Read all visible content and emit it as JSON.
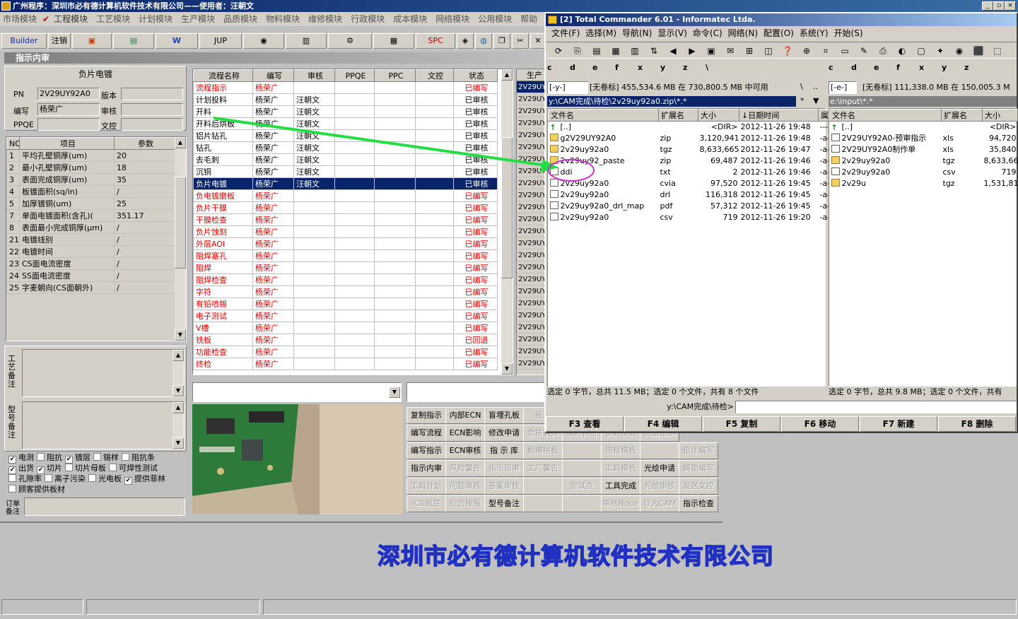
{
  "app": {
    "title": "广州程序：深圳市必有德计算机软件技术有限公司——使用者：汪朝文",
    "menus": [
      "市场模块",
      "工程模块",
      "工艺模块",
      "计划模块",
      "生产模块",
      "品质模块",
      "物料模块",
      "维修模块",
      "行政模块",
      "成本模块",
      "网络模块",
      "公用模块",
      "帮助"
    ],
    "toolbar": {
      "builder": "Builder",
      "logout": "注销",
      "jup": "JUP",
      "spc": "SPC"
    },
    "section_title": "指示内审"
  },
  "left": {
    "heading": "负片电镀",
    "pn_label": "PN",
    "pn_value": "2V29UY92A0",
    "version_label": "版本",
    "version_value": "",
    "author_label": "编写",
    "author_value": "杨荣广",
    "review_label": "审核",
    "review_value": "",
    "ppqe_label": "PPQE",
    "ppqe_value": "",
    "doc_label": "文控",
    "doc_value": "",
    "param_headers": [
      "NO",
      "项目",
      "参数"
    ],
    "params": [
      {
        "no": "1",
        "item": "平均孔壁铜厚(um)",
        "val": "20"
      },
      {
        "no": "2",
        "item": "最小孔壁铜厚(um)",
        "val": "18"
      },
      {
        "no": "3",
        "item": "表面完成铜厚(um)",
        "val": "35"
      },
      {
        "no": "4",
        "item": "板镀面积(sq/in)",
        "val": "/"
      },
      {
        "no": "5",
        "item": "加厚镀铜(um)",
        "val": "25"
      },
      {
        "no": "7",
        "item": "单面电镀面积(含孔)(",
        "val": "351.17"
      },
      {
        "no": "8",
        "item": "表面最小完成铜厚(μm)",
        "val": "/"
      },
      {
        "no": "21",
        "item": "电镀线别",
        "val": "/"
      },
      {
        "no": "22",
        "item": "电镀时间",
        "val": "/"
      },
      {
        "no": "23",
        "item": "CS面电流密度",
        "val": "/"
      },
      {
        "no": "24",
        "item": "SS面电流密度",
        "val": "/"
      },
      {
        "no": "25",
        "item": "字麦朝向(CS面朝外)",
        "val": "/"
      }
    ],
    "process_note_label": "工艺备注",
    "model_note_label": "型号备注",
    "order_note_label": "订单备注",
    "checkboxes": [
      [
        {
          "label": "电测",
          "checked": true
        },
        {
          "label": "阻抗",
          "checked": false
        },
        {
          "label": "镀层",
          "checked": true
        },
        {
          "label": "锡样",
          "checked": false
        },
        {
          "label": "阻抗条",
          "checked": false
        }
      ],
      [
        {
          "label": "出货",
          "checked": true
        },
        {
          "label": "切片",
          "checked": true
        },
        {
          "label": "切片母板",
          "checked": false
        },
        {
          "label": "可焊性测试",
          "checked": false
        }
      ],
      [
        {
          "label": "孔隙率",
          "checked": false
        },
        {
          "label": "离子污染",
          "checked": false
        },
        {
          "label": "光电板",
          "checked": false
        },
        {
          "label": "提供菲林",
          "checked": true
        }
      ],
      [
        {
          "label": "顾客提供板材",
          "checked": false
        }
      ]
    ]
  },
  "flow": {
    "headers": [
      "流程名称",
      "编写",
      "审核",
      "PPQE",
      "PPC",
      "文控",
      "状态"
    ],
    "rows": [
      {
        "name": "流程指示",
        "author": "杨荣广",
        "review": "",
        "status": "已编写",
        "red": true
      },
      {
        "name": "计划投料",
        "author": "杨荣广",
        "review": "汪朝文",
        "status": "已审核",
        "red": false
      },
      {
        "name": "开料",
        "author": "杨荣广",
        "review": "汪朝文",
        "status": "已审核",
        "red": false
      },
      {
        "name": "开料后烘板",
        "author": "杨荣广",
        "review": "汪朝文",
        "status": "已审核",
        "red": false
      },
      {
        "name": "铝片钻孔",
        "author": "杨荣广",
        "review": "汪朝文",
        "status": "已审核",
        "red": false
      },
      {
        "name": "钻孔",
        "author": "杨荣广",
        "review": "汪朝文",
        "status": "已审核",
        "red": false
      },
      {
        "name": "去毛刺",
        "author": "杨荣广",
        "review": "汪朝文",
        "status": "已审核",
        "red": false
      },
      {
        "name": "沉铜",
        "author": "杨荣广",
        "review": "汪朝文",
        "status": "已审核",
        "red": false
      },
      {
        "name": "负片电镀",
        "author": "杨荣广",
        "review": "汪朝文",
        "status": "已审核",
        "red": false,
        "selected": true
      },
      {
        "name": "负电镀磨板",
        "author": "杨荣广",
        "review": "",
        "status": "已编写",
        "red": true
      },
      {
        "name": "负片干膜",
        "author": "杨荣广",
        "review": "",
        "status": "已编写",
        "red": true
      },
      {
        "name": "干膜检查",
        "author": "杨荣广",
        "review": "",
        "status": "已编写",
        "red": true
      },
      {
        "name": "负片蚀刻",
        "author": "杨荣广",
        "review": "",
        "status": "已编写",
        "red": true
      },
      {
        "name": "外层AOI",
        "author": "杨荣广",
        "review": "",
        "status": "已编写",
        "red": true
      },
      {
        "name": "阻焊塞孔",
        "author": "杨荣广",
        "review": "",
        "status": "已编写",
        "red": true
      },
      {
        "name": "阻焊",
        "author": "杨荣广",
        "review": "",
        "status": "已编写",
        "red": true
      },
      {
        "name": "阻焊检查",
        "author": "杨荣广",
        "review": "",
        "status": "已编写",
        "red": true
      },
      {
        "name": "字符",
        "author": "杨荣广",
        "review": "",
        "status": "已编写",
        "red": true
      },
      {
        "name": "有铅喷锡",
        "author": "杨荣广",
        "review": "",
        "status": "已编写",
        "red": true
      },
      {
        "name": "电子测试",
        "author": "杨荣广",
        "review": "",
        "status": "已编写",
        "red": true
      },
      {
        "name": "V槽",
        "author": "杨荣广",
        "review": "",
        "status": "已编写",
        "red": true
      },
      {
        "name": "铣板",
        "author": "杨荣广",
        "review": "",
        "status": "已回退",
        "red": true
      },
      {
        "name": "功能检查",
        "author": "杨荣广",
        "review": "",
        "status": "已编写",
        "red": true
      },
      {
        "name": "终检",
        "author": "杨荣广",
        "review": "",
        "status": "已编写",
        "red": true
      }
    ],
    "side_header": "生产",
    "side_values": [
      "2V29UY",
      "2V29UY",
      "2V29UY",
      "2V29UY",
      "2V29UY",
      "2V29UY",
      "2V29UY",
      "2V29UY",
      "2V29UY",
      "2V29UY",
      "2V29UY",
      "2V29UY",
      "2V29UY",
      "2V29UY",
      "2V29UY",
      "2V29UY",
      "2V29UY",
      "2V29UY",
      "2V29UY",
      "2V29UY",
      "2V29UY",
      "2V29UY",
      "2V29UY",
      "2V29UY"
    ]
  },
  "actions": [
    [
      {
        "label": "复制指示",
        "en": true
      },
      {
        "label": "内部ECN",
        "en": true
      },
      {
        "label": "盲埋孔板",
        "en": true
      },
      {
        "label": "报价",
        "en": false
      }
    ],
    [
      {
        "label": "编写流程",
        "en": true
      },
      {
        "label": "ECN影响",
        "en": true
      },
      {
        "label": "修改申请",
        "en": true
      },
      {
        "label": "合拼表择",
        "en": false
      },
      {
        "label": "取消合拼",
        "en": false
      },
      {
        "label": "参数模板",
        "en": false
      },
      {
        "label": "回退指示",
        "en": false
      }
    ],
    [
      {
        "label": "编写指示",
        "en": true
      },
      {
        "label": "ECN审核",
        "en": true
      },
      {
        "label": "指 示 库",
        "en": true
      },
      {
        "label": "粗略拼板",
        "en": false
      },
      {
        "label": "",
        "en": false
      },
      {
        "label": "流程模板",
        "en": false
      },
      {
        "label": "",
        "en": false
      },
      {
        "label": "锁住编写",
        "en": false
      }
    ],
    [
      {
        "label": "指示内审",
        "en": true
      },
      {
        "label": "风险警告",
        "en": false
      },
      {
        "label": "指示退审",
        "en": false
      },
      {
        "label": "工厂警告",
        "en": false
      },
      {
        "label": "",
        "en": false
      },
      {
        "label": "工具模板",
        "en": false
      },
      {
        "label": "光绘申请",
        "en": true
      },
      {
        "label": "解锁编写",
        "en": false
      }
    ],
    [
      {
        "label": "工具计划",
        "en": false
      },
      {
        "label": "问题审核",
        "en": false
      },
      {
        "label": "答案审核",
        "en": false
      },
      {
        "label": "",
        "en": false
      },
      {
        "label": "测试点",
        "en": false
      },
      {
        "label": "工具完成",
        "en": true
      },
      {
        "label": "光绘审核",
        "en": false
      },
      {
        "label": "发送文控",
        "en": false
      }
    ],
    [
      {
        "label": "ICS跟踪",
        "en": false
      },
      {
        "label": "组合排版",
        "en": false
      },
      {
        "label": "型号备注",
        "en": true
      },
      {
        "label": "",
        "en": false
      },
      {
        "label": "",
        "en": false
      },
      {
        "label": "审核Nope",
        "en": false
      },
      {
        "label": "导入CAM",
        "en": false
      },
      {
        "label": "指示检查",
        "en": true
      }
    ]
  ],
  "tc": {
    "title": "[2] Total Commander 6.01 - Informatec Ltda.",
    "menus": [
      "文件(F)",
      "选择(M)",
      "导航(N)",
      "显示(V)",
      "命令(C)",
      "网络(N)",
      "配置(O)",
      "系统(Y)",
      "开始(S)"
    ],
    "drives_left": [
      "c",
      "d",
      "e",
      "f",
      "x",
      "y",
      "z",
      "\\"
    ],
    "drives_right": [
      "c",
      "d",
      "e",
      "f",
      "x",
      "y",
      "z"
    ],
    "left_drive": "[-y-]",
    "left_free": "[无卷标]  455,534.6 MB 在 730,800.5 MB 中可用",
    "left_path": "y:\\CAM完成\\待检\\2v29uy92a0.zip\\*.*",
    "right_drive": "[-e-]",
    "right_free": "[无卷标]  111,338.0 MB 在 150,005.3 M",
    "right_path": "e:\\input\\*.*",
    "cols": [
      "文件名",
      "扩展名",
      "大小",
      "↓日期时间",
      "属"
    ],
    "rcols": [
      "文件名",
      "扩展名",
      "大小"
    ],
    "left_files": [
      {
        "name": "[..]",
        "ext": "",
        "size": "<DIR>",
        "date": "2012-11-26 19:48",
        "attr": "----",
        "type": "up"
      },
      {
        "name": "g2V29UY92A0",
        "ext": "zip",
        "size": "3,120,941",
        "date": "2012-11-26 19:48",
        "attr": "-a-",
        "type": "file"
      },
      {
        "name": "2v29uy92a0",
        "ext": "tgz",
        "size": "8,633,665",
        "date": "2012-11-26 19:47",
        "attr": "-a-",
        "type": "file"
      },
      {
        "name": "2v29uy92_paste",
        "ext": "zip",
        "size": "69,487",
        "date": "2012-11-26 19:46",
        "attr": "-a-",
        "type": "file"
      },
      {
        "name": "ddi",
        "ext": "txt",
        "size": "2",
        "date": "2012-11-26 19:46",
        "attr": "-a-",
        "type": "doc"
      },
      {
        "name": "2v29uy92a0",
        "ext": "cvia",
        "size": "97,520",
        "date": "2012-11-26 19:45",
        "attr": "-a-",
        "type": "doc"
      },
      {
        "name": "2v29uy92a0",
        "ext": "drl",
        "size": "116,318",
        "date": "2012-11-26 19:45",
        "attr": "-a-",
        "type": "doc"
      },
      {
        "name": "2v29uy92a0_drl_map",
        "ext": "pdf",
        "size": "57,312",
        "date": "2012-11-26 19:45",
        "attr": "-a-",
        "type": "doc"
      },
      {
        "name": "2v29uy92a0",
        "ext": "csv",
        "size": "719",
        "date": "2012-11-26 19:20",
        "attr": "-a-",
        "type": "doc"
      }
    ],
    "right_files": [
      {
        "name": "[..]",
        "ext": "",
        "size": "<DIR>",
        "type": "up"
      },
      {
        "name": "2V29UY92A0-预审指示",
        "ext": "xls",
        "size": "94,720",
        "type": "doc"
      },
      {
        "name": "2V29UY92A0制作单",
        "ext": "xls",
        "size": "35,840",
        "type": "doc"
      },
      {
        "name": "2v29uy92a0",
        "ext": "tgz",
        "size": "8,633,665",
        "type": "file"
      },
      {
        "name": "2v29uy92a0",
        "ext": "csv",
        "size": "719",
        "type": "doc"
      },
      {
        "name": "2v29u",
        "ext": "tgz",
        "size": "1,531,819",
        "type": "file"
      }
    ],
    "left_status": "选定 0 字节，总共 11.5 MB；选定 0 个文件，共有 8 个文件",
    "right_status": "选定 0 字节，总共 9.8 MB；选定 0 个文件，共有",
    "cmd_label": "y:\\CAM完成\\待检>",
    "fkeys": [
      "F3 查看",
      "F4 编辑",
      "F5 复制",
      "F6 移动",
      "F7 新建",
      "F8 删除"
    ]
  },
  "banner": "深圳市必有德计算机软件技术有限公司",
  "colors": {
    "titlebar": "#0a246a",
    "red_status": "#e00000",
    "arrow": "#22dd44",
    "circle": "#cc33cc",
    "banner_stroke": "#2030c0"
  }
}
